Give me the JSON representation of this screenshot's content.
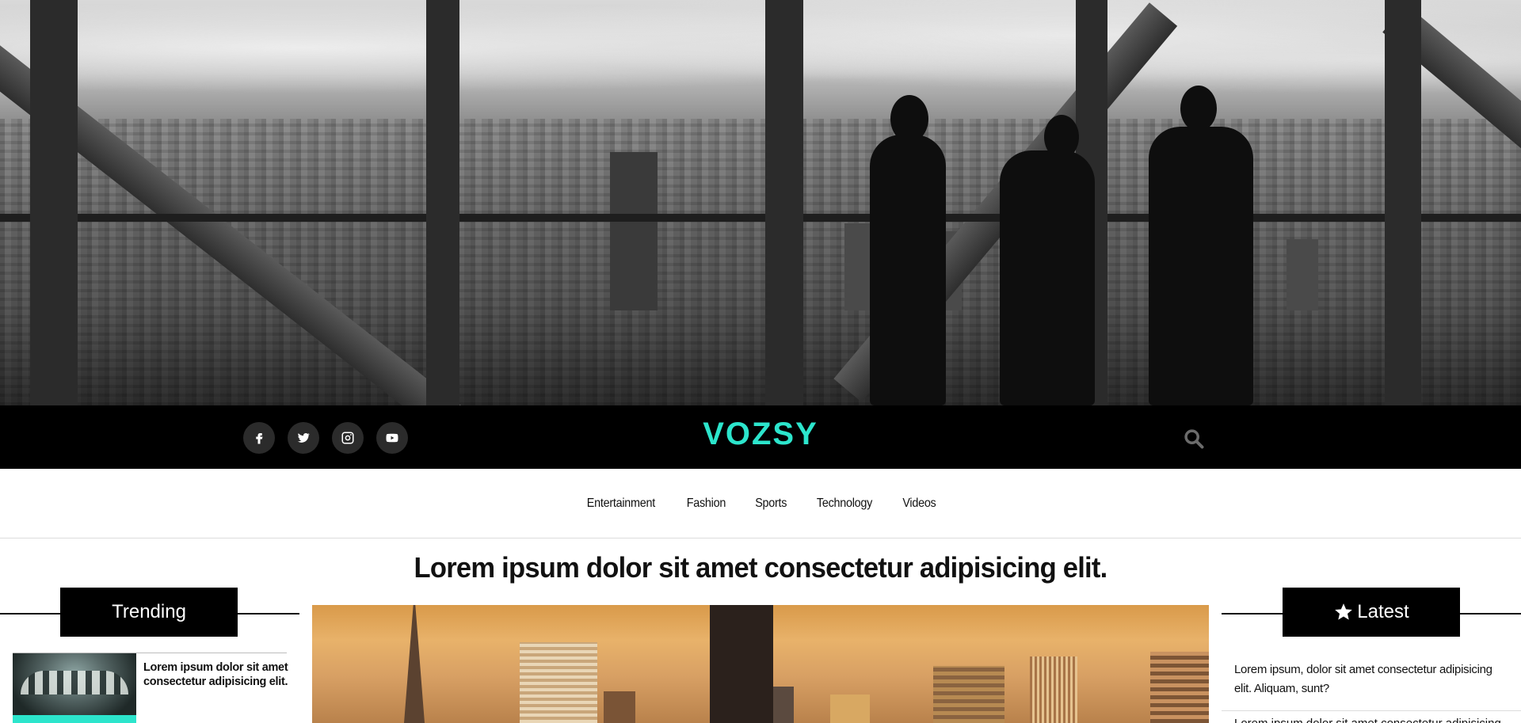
{
  "header": {
    "logo": "VOZSY",
    "social": [
      {
        "name": "facebook-icon"
      },
      {
        "name": "twitter-icon"
      },
      {
        "name": "instagram-icon"
      },
      {
        "name": "youtube-icon"
      }
    ],
    "search_icon": "search-icon",
    "accent_color": "#2ce5cc"
  },
  "nav": {
    "items": [
      "Entertainment",
      "Fashion",
      "Sports",
      "Technology",
      "Videos"
    ]
  },
  "main": {
    "headline": "Lorem ipsum dolor sit amet consectetur adipisicing elit."
  },
  "trending": {
    "title": "Trending",
    "items": [
      {
        "text": "Lorem ipsum dolor sit amet consectetur adipisicing elit."
      }
    ]
  },
  "latest": {
    "title": "Latest",
    "icon": "star-icon",
    "items": [
      {
        "text": "Lorem ipsum, dolor sit amet consectetur adipisicing elit. Aliquam, sunt?"
      },
      {
        "text": "Lorem ipsum dolor sit amet consectetur adipisicing elit."
      }
    ]
  }
}
